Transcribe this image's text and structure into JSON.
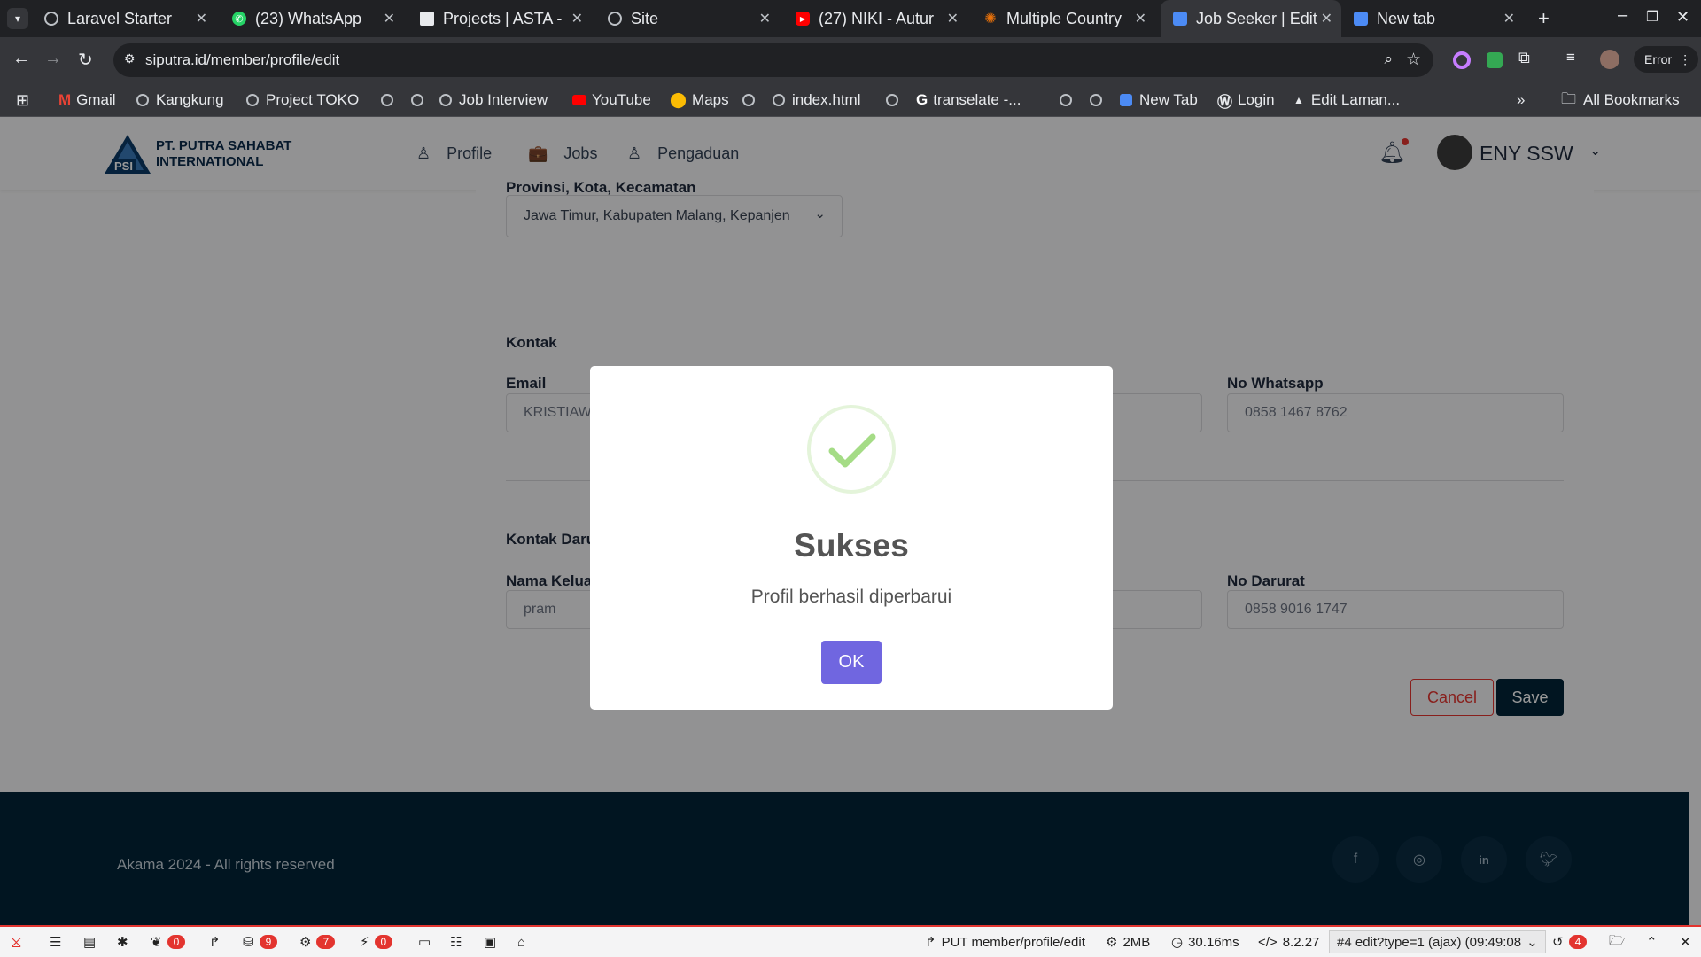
{
  "browser": {
    "tabs": [
      {
        "title": "Laravel Starter"
      },
      {
        "title": "(23) WhatsApp"
      },
      {
        "title": "Projects | ASTA -"
      },
      {
        "title": "Site"
      },
      {
        "title": "(27) NIKI - Autur"
      },
      {
        "title": "Multiple Country"
      },
      {
        "title": "Job Seeker | Edit",
        "active": true
      },
      {
        "title": "New tab"
      }
    ],
    "url": "siputra.id/member/profile/edit",
    "profile_status": "Error",
    "bookmarks": [
      "Gmail",
      "Kangkung",
      "Project TOKO",
      "Job Interview",
      "YouTube",
      "Maps",
      "index.html",
      "transelate -...",
      "New Tab",
      "Login",
      "Edit Laman..."
    ],
    "all_bookmarks": "All Bookmarks"
  },
  "site": {
    "logo_initials": "PSI",
    "company_line1": "PT. PUTRA SAHABAT",
    "company_line2": "INTERNATIONAL",
    "nav": {
      "profile": "Profile",
      "jobs": "Jobs",
      "pengaduan": "Pengaduan"
    },
    "user_name": "ENY SSW"
  },
  "form": {
    "province_label": "Provinsi, Kota, Kecamatan",
    "province_value": "Jawa Timur, Kabupaten Malang, Kepanjen",
    "kontak_heading": "Kontak",
    "email_label": "Email",
    "email_value": "KRISTIAWA",
    "whatsapp_label": "No Whatsapp",
    "whatsapp_value": "0858 1467 8762",
    "darurat_heading": "Kontak Daru",
    "nama_keluarga_label": "Nama Keluar",
    "nama_keluarga_value": "pram",
    "no_darurat_label": "No Darurat",
    "no_darurat_value": "0858 9016 1747",
    "cancel": "Cancel",
    "save": "Save"
  },
  "footer": {
    "copyright": "Akama 2024 - All rights reserved",
    "social": [
      "facebook-icon",
      "instagram-icon",
      "linkedin-icon",
      "twitter-icon"
    ]
  },
  "debugbar": {
    "badges": {
      "messages": "0",
      "queries": "9",
      "models": "7",
      "events": "0"
    },
    "request": "PUT member/profile/edit",
    "memory": "2MB",
    "time": "30.16ms",
    "php": "8.2.27",
    "request_select": "#4 edit?type=1 (ajax) (09:49:08",
    "history_count": "4"
  },
  "modal": {
    "title": "Sukses",
    "message": "Profil berhasil diperbarui",
    "ok": "OK",
    "success_color": "#a5dc86",
    "button_color": "#7066e0"
  },
  "colors": {
    "primary": "#022338",
    "danger": "#e3342f"
  }
}
